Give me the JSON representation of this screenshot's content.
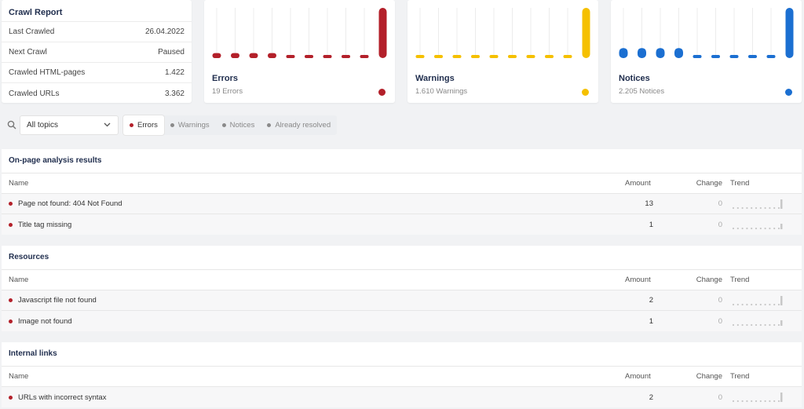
{
  "crawl_report": {
    "title": "Crawl Report",
    "rows": [
      {
        "label": "Last Crawled",
        "value": "26.04.2022"
      },
      {
        "label": "Next Crawl",
        "value": "Paused"
      },
      {
        "label": "Crawled HTML-pages",
        "value": "1.422"
      },
      {
        "label": "Crawled URLs",
        "value": "3.362"
      }
    ]
  },
  "stats": [
    {
      "name": "Errors",
      "sub": "19 Errors",
      "color": "#b3202a",
      "bars": [
        2,
        2,
        2,
        2,
        1,
        1,
        1,
        1,
        1,
        19
      ]
    },
    {
      "name": "Warnings",
      "sub": "1.610 Warnings",
      "color": "#f5c000",
      "bars": [
        1,
        1,
        1,
        1,
        1,
        1,
        1,
        1,
        1,
        19
      ]
    },
    {
      "name": "Notices",
      "sub": "2.205 Notices",
      "color": "#1b6fd1",
      "bars": [
        4,
        4,
        4,
        4,
        1,
        1,
        1,
        1,
        1,
        19
      ]
    }
  ],
  "filter_bar": {
    "topic_select": "All topics",
    "filters": [
      "Errors",
      "Warnings",
      "Notices",
      "Already resolved"
    ]
  },
  "table_headers": {
    "name": "Name",
    "amount": "Amount",
    "change": "Change",
    "trend": "Trend"
  },
  "sections": [
    {
      "title": "On-page analysis results",
      "rows": [
        {
          "name": "Page not found: 404 Not Found",
          "amount": "13",
          "change": "0"
        },
        {
          "name": "Title tag missing",
          "amount": "1",
          "change": "0"
        }
      ]
    },
    {
      "title": "Resources",
      "rows": [
        {
          "name": "Javascript file not found",
          "amount": "2",
          "change": "0"
        },
        {
          "name": "Image not found",
          "amount": "1",
          "change": "0"
        }
      ]
    },
    {
      "title": "Internal links",
      "rows": [
        {
          "name": "URLs with incorrect syntax",
          "amount": "2",
          "change": "0"
        }
      ]
    }
  ]
}
